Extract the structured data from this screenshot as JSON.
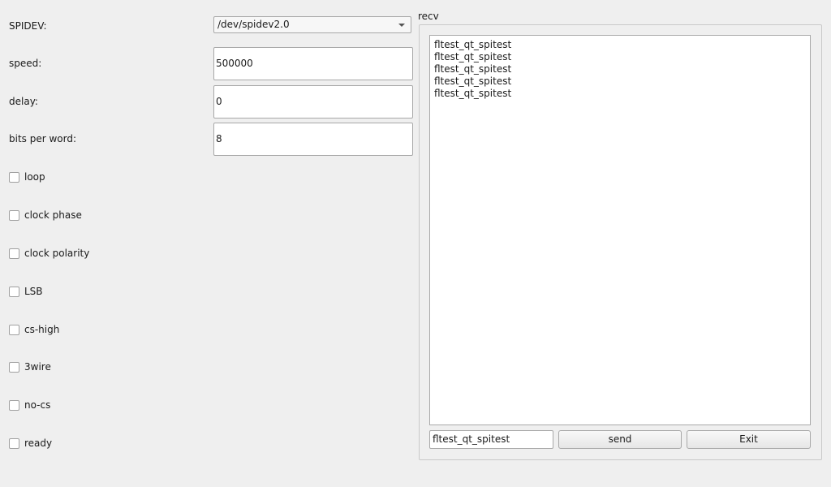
{
  "left": {
    "spidev_label": "SPIDEV:",
    "spidev_value": "/dev/spidev2.0",
    "speed_label": "speed:",
    "speed_value": "500000",
    "delay_label": "delay:",
    "delay_value": "0",
    "bits_label": "bits per word:",
    "bits_value": "8",
    "checkboxes": [
      {
        "label": "loop",
        "checked": false
      },
      {
        "label": "clock phase",
        "checked": false
      },
      {
        "label": "clock polarity",
        "checked": false
      },
      {
        "label": "LSB",
        "checked": false
      },
      {
        "label": "cs-high",
        "checked": false
      },
      {
        "label": "3wire",
        "checked": false
      },
      {
        "label": "no-cs",
        "checked": false
      },
      {
        "label": "ready",
        "checked": false
      }
    ]
  },
  "recv": {
    "title": "recv",
    "lines": [
      "fltest_qt_spitest",
      "fltest_qt_spitest",
      "fltest_qt_spitest",
      "fltest_qt_spitest",
      "fltest_qt_spitest"
    ],
    "input_value": "fltest_qt_spitest",
    "send_label": "send",
    "exit_label": "Exit"
  }
}
